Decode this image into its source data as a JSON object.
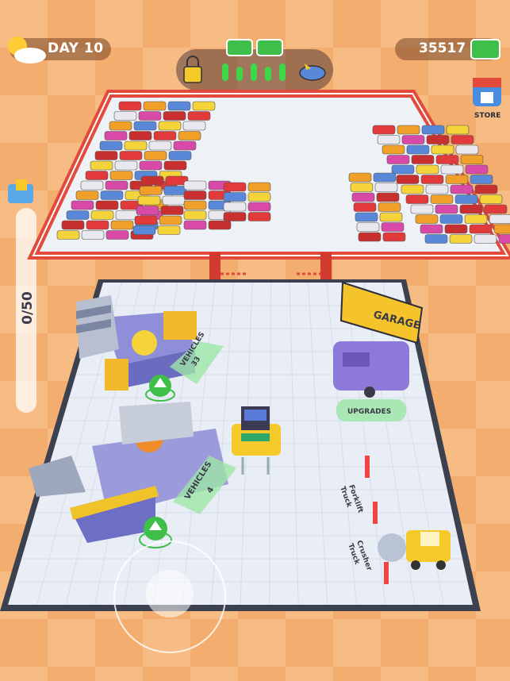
{
  "hud": {
    "day_label": "DAY 10",
    "money": "35517",
    "store_label": "STORE",
    "progress_text": "0/50",
    "progress_value": 0,
    "progress_max": 50,
    "unlock_bars": 5,
    "unlock_bars_filled": 3
  },
  "world": {
    "vehicles_zone_1_label": "VEHICLES",
    "vehicles_zone_1_count": "33",
    "vehicles_zone_2_label": "VEHICLES",
    "vehicles_zone_2_count": "4",
    "upgrades_label": "UPGRADES",
    "garage_sign": "GARAGE",
    "forklift_truck_label": "Forklift\nTruck",
    "crusher_truck_label": "Crusher\nTruck"
  },
  "colors": {
    "floor": "#e8edf5",
    "wall": "#e24a3c",
    "accent_green": "#3fbf4a",
    "hud_bg": "#7a4a2e"
  },
  "icons": [
    "sun-cloud-icon",
    "cash-stack-icon",
    "lock-icon",
    "flying-car-icon",
    "store-icon",
    "forklift-icon",
    "arrow-up-icon",
    "joystick-icon"
  ]
}
